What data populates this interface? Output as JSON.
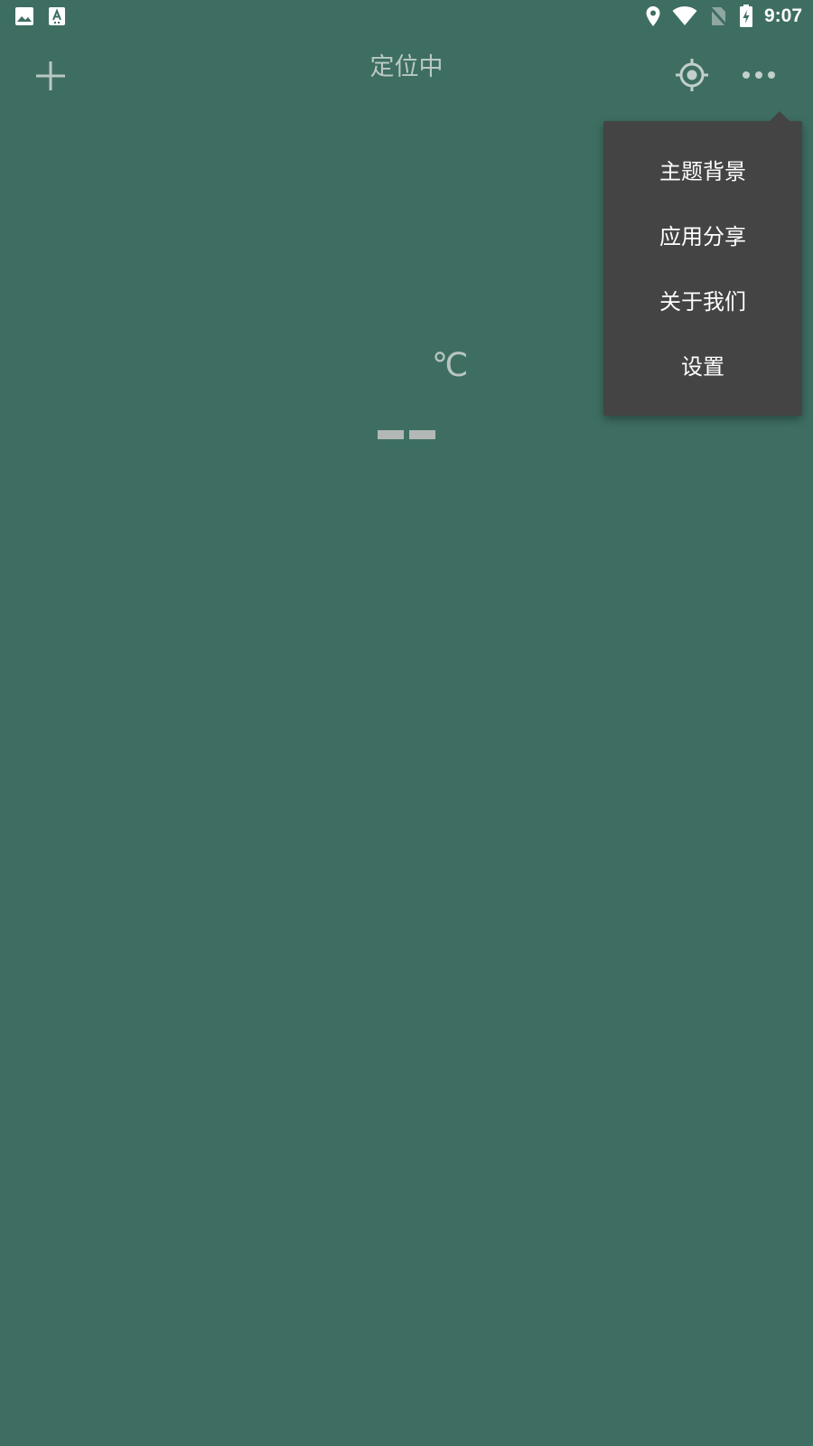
{
  "status_bar": {
    "time": "9:07",
    "left_icons": [
      "image-icon",
      "text-font-icon"
    ],
    "right_icons": [
      "location-pin-icon",
      "wifi-icon",
      "no-sim-icon",
      "battery-charging-icon"
    ]
  },
  "app_bar": {
    "title": "定位中",
    "add_icon": "plus-icon",
    "locate_icon": "gps-target-icon",
    "more_icon": "more-horizontal-icon"
  },
  "weather": {
    "temperature_unit": "℃",
    "placeholder": "——"
  },
  "overflow_menu": {
    "items": [
      {
        "label": "主题背景"
      },
      {
        "label": "应用分享"
      },
      {
        "label": "关于我们"
      },
      {
        "label": "设置"
      }
    ]
  },
  "colors": {
    "background": "#3e6e62",
    "menu_background": "#444444",
    "menu_text": "#ffffff",
    "title_text": "#b9c8c3"
  }
}
